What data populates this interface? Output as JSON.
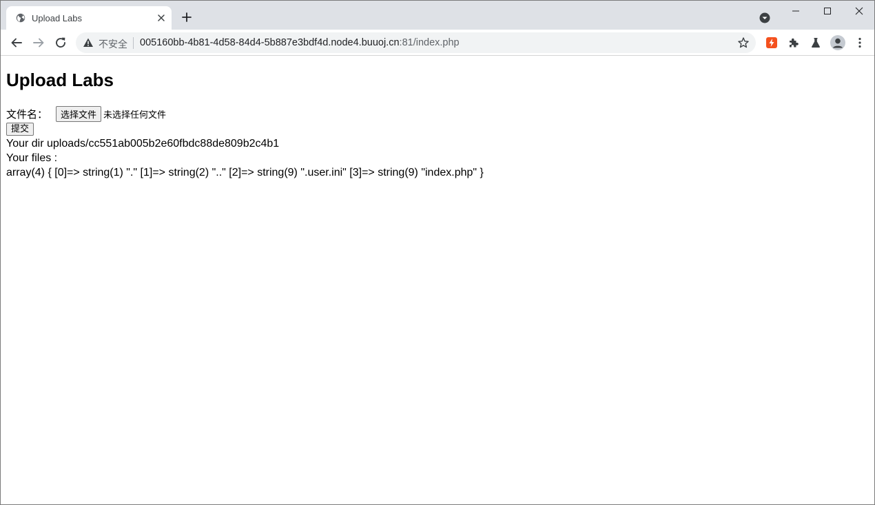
{
  "browser": {
    "tab": {
      "title": "Upload Labs"
    },
    "omnibox": {
      "security_label": "不安全",
      "url_host": "005160bb-4b81-4d58-84d4-5b887e3bdf4d.node4.buuoj.cn",
      "url_rest": ":81/index.php"
    },
    "icons": {
      "favicon": "globe-icon",
      "tab_close": "close-icon",
      "new_tab": "plus-icon",
      "tab_search": "tab-search-icon",
      "minimize": "minimize-icon",
      "maximize": "maximize-icon",
      "close_window": "close-icon",
      "back": "back-arrow-icon",
      "forward": "forward-arrow-icon",
      "reload": "reload-icon",
      "warning": "warning-icon",
      "bookmark": "star-icon",
      "extension_1": "lightning-extension-icon",
      "extensions": "puzzle-icon",
      "labs": "flask-icon",
      "profile": "avatar-icon",
      "menu": "kebab-menu-icon"
    },
    "colors": {
      "tabstrip_bg": "#dee1e6",
      "omnibox_bg": "#f1f3f4",
      "extension_accent": "#f4511e"
    }
  },
  "page": {
    "heading": "Upload Labs",
    "file_label": "文件名：",
    "file_button": "选择文件",
    "file_status": "未选择任何文件",
    "submit_button": "提交",
    "dir_line": "Your dir uploads/cc551ab005b2e60fbdc88de809b2c4b1",
    "files_line": "Your files :",
    "array_line": "array(4) { [0]=> string(1) \".\" [1]=> string(2) \"..\" [2]=> string(9) \".user.ini\" [3]=> string(9) \"index.php\" }"
  }
}
